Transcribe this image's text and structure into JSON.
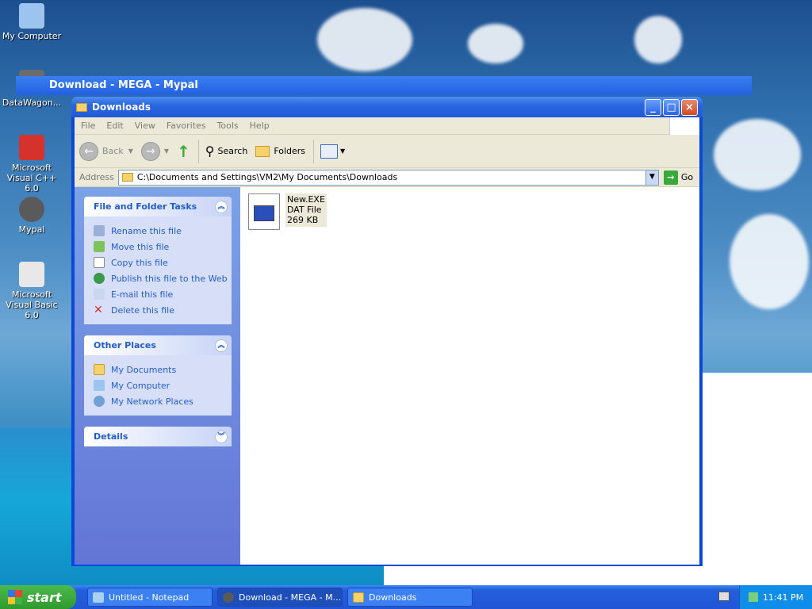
{
  "desktop": {
    "icons": [
      {
        "label": "My Computer"
      },
      {
        "label": "DataWagon..."
      },
      {
        "label": "Microsoft Visual C++ 6.0"
      },
      {
        "label": "Mypal"
      },
      {
        "label": "Microsoft Visual Basic 6.0"
      }
    ]
  },
  "background_window": {
    "title": "Download - MEGA - Mypal"
  },
  "window": {
    "title": "Downloads",
    "menu": [
      "File",
      "Edit",
      "View",
      "Favorites",
      "Tools",
      "Help"
    ],
    "toolbar": {
      "back": "Back",
      "search": "Search",
      "folders": "Folders"
    },
    "address": {
      "label": "Address",
      "path": "C:\\Documents and Settings\\VM2\\My Documents\\Downloads",
      "go": "Go"
    },
    "tasks": {
      "title": "File and Folder Tasks",
      "items": [
        "Rename this file",
        "Move this file",
        "Copy this file",
        "Publish this file to the Web",
        "E-mail this file",
        "Delete this file"
      ]
    },
    "other_places": {
      "title": "Other Places",
      "items": [
        "My Documents",
        "My Computer",
        "My Network Places"
      ]
    },
    "details": {
      "title": "Details"
    },
    "file": {
      "name": "New.EXE",
      "type": "DAT File",
      "size": "269 KB"
    }
  },
  "taskbar": {
    "start": "start",
    "tasks": [
      "Untitled - Notepad",
      "Download - MEGA - M...",
      "Downloads"
    ],
    "clock": "11:41 PM"
  },
  "colors": {
    "xp_blue": "#0a49d8",
    "task_link": "#215dc6",
    "start_green": "#2f9a2f"
  }
}
